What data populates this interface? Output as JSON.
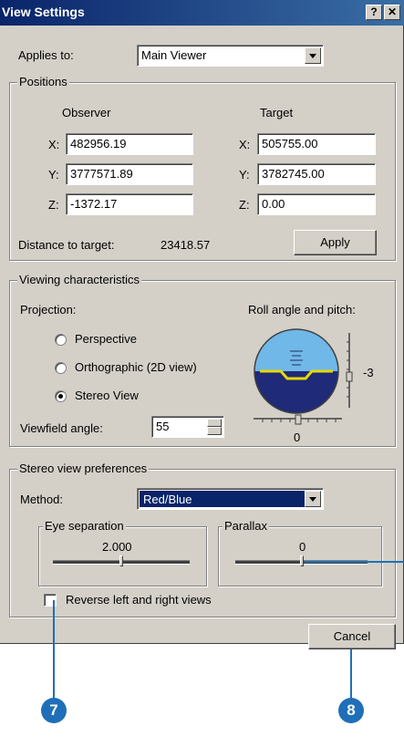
{
  "window": {
    "title": "View Settings",
    "help_glyph": "?",
    "close_glyph": "✕"
  },
  "applies_to": {
    "label": "Applies to:",
    "value": "Main Viewer"
  },
  "positions": {
    "legend": "Positions",
    "observer_header": "Observer",
    "target_header": "Target",
    "x_label": "X:",
    "y_label": "Y:",
    "z_label": "Z:",
    "observer": {
      "x": "482956.19",
      "y": "3777571.89",
      "z": "-1372.17"
    },
    "target": {
      "x": "505755.00",
      "y": "3782745.00",
      "z": "0.00"
    },
    "distance_label": "Distance to target:",
    "distance_value": "23418.57",
    "apply_label": "Apply"
  },
  "viewing": {
    "legend": "Viewing characteristics",
    "projection_label": "Projection:",
    "options": [
      "Perspective",
      "Orthographic (2D view)",
      "Stereo View"
    ],
    "selected_option": "Stereo View",
    "roll_label": "Roll angle and pitch:",
    "pitch_value": "-3",
    "roll_value": "0",
    "viewfield_label": "Viewfield angle:",
    "viewfield_value": "55"
  },
  "stereo": {
    "legend": "Stereo view preferences",
    "method_label": "Method:",
    "method_value": "Red/Blue",
    "eye_legend": "Eye separation",
    "eye_value": "2.000",
    "parallax_legend": "Parallax",
    "parallax_value": "0",
    "reverse_label": "Reverse left and right views",
    "reverse_checked": false
  },
  "cancel_label": "Cancel",
  "callouts": [
    "7",
    "8"
  ],
  "colors": {
    "title_bar": "#0a246a",
    "selection": "#0a246a",
    "callout": "#1f6fb8",
    "horizon_sky": "#6fb8e8",
    "horizon_ground": "#1f2a78",
    "horizon_line": "#e8d800"
  }
}
